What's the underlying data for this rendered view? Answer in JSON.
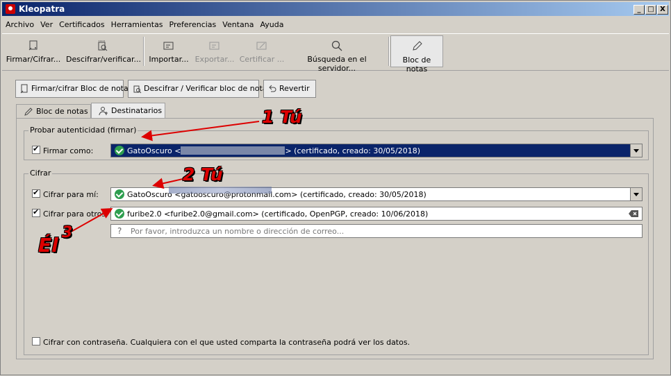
{
  "window": {
    "title": "Kleopatra",
    "min": "_",
    "max": "□",
    "close": "X"
  },
  "menu": [
    "Archivo",
    "Ver",
    "Certificados",
    "Herramientas",
    "Preferencias",
    "Ventana",
    "Ayuda"
  ],
  "toolbar": {
    "sign_encrypt": "Firmar/Cifrar...",
    "decrypt_verify": "Descifrar/verificar...",
    "import": "Importar...",
    "export": "Exportar...",
    "certify": "Certificar ...",
    "server_search": "Búsqueda en el servidor...",
    "notepad": "Bloc de notas"
  },
  "actions": {
    "sign_encrypt_notepad": "Firmar/cifrar Bloc de notas",
    "decrypt_verify_notepad": "Descifrar / Verificar bloc de notas",
    "revert": "Revertir"
  },
  "tabs": {
    "notepad": "Bloc de notas",
    "recipients": "Destinatarios"
  },
  "sign_group": {
    "title": "Probar autenticidad (firmar)",
    "sign_as_label": "Firmar como:",
    "sign_as_checked": true,
    "sign_as_name": "GatoOscuro <",
    "sign_as_suffix": "> (certificado,  creado: 30/05/2018)"
  },
  "encrypt_group": {
    "title": "Cifrar",
    "for_me_label": "Cifrar para mí:",
    "for_me_checked": true,
    "for_me_value": "GatoOscuro <gatooscuro@protonmail.com> (certificado,  creado: 30/05/2018)",
    "for_others_label": "Cifrar para otros:",
    "for_others_checked": true,
    "for_others_value": "furibe2.0 <furibe2.0@gmail.com> (certificado, OpenPGP, creado: 10/06/2018)",
    "recipient_placeholder": "Por favor, introduzca un nombre o dirección de correo...",
    "password_label": "Cifrar con contraseña. Cualquiera con el que usted comparta la contraseña podrá ver los datos.",
    "password_checked": false
  },
  "annotations": {
    "one": "1 Tú",
    "two": "2 Tú",
    "three": "3",
    "el": "Él"
  }
}
